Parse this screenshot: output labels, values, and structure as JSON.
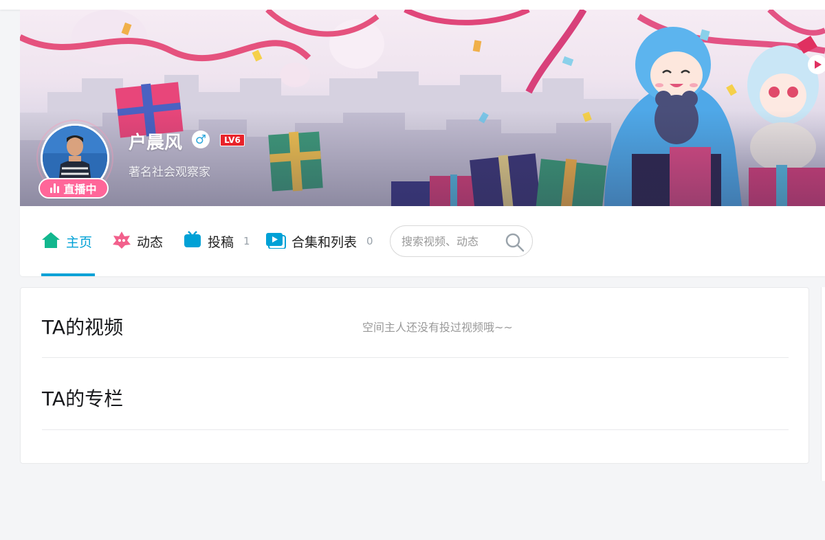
{
  "profile": {
    "username": "户晨风",
    "gender_symbol": "♂",
    "level": "LV6",
    "sign": "著名社会观察家",
    "live_label": "直播中"
  },
  "nav": {
    "tabs": [
      {
        "label": "主页",
        "count": "",
        "icon": "home-icon",
        "active": true
      },
      {
        "label": "动态",
        "count": "",
        "icon": "dynamic-icon",
        "active": false
      },
      {
        "label": "投稿",
        "count": "1",
        "icon": "upload-icon",
        "active": false
      },
      {
        "label": "合集和列表",
        "count": "0",
        "icon": "collection-icon",
        "active": false
      }
    ],
    "search_placeholder": "搜索视频、动态"
  },
  "sections": {
    "videos_title": "TA的视频",
    "videos_empty": "空间主人还没有投过视频哦~~",
    "articles_title": "TA的专栏"
  },
  "colors": {
    "accent": "#00a1d6",
    "live": "#ff6699",
    "level": "#e8232a",
    "background": "#f4f5f7"
  }
}
